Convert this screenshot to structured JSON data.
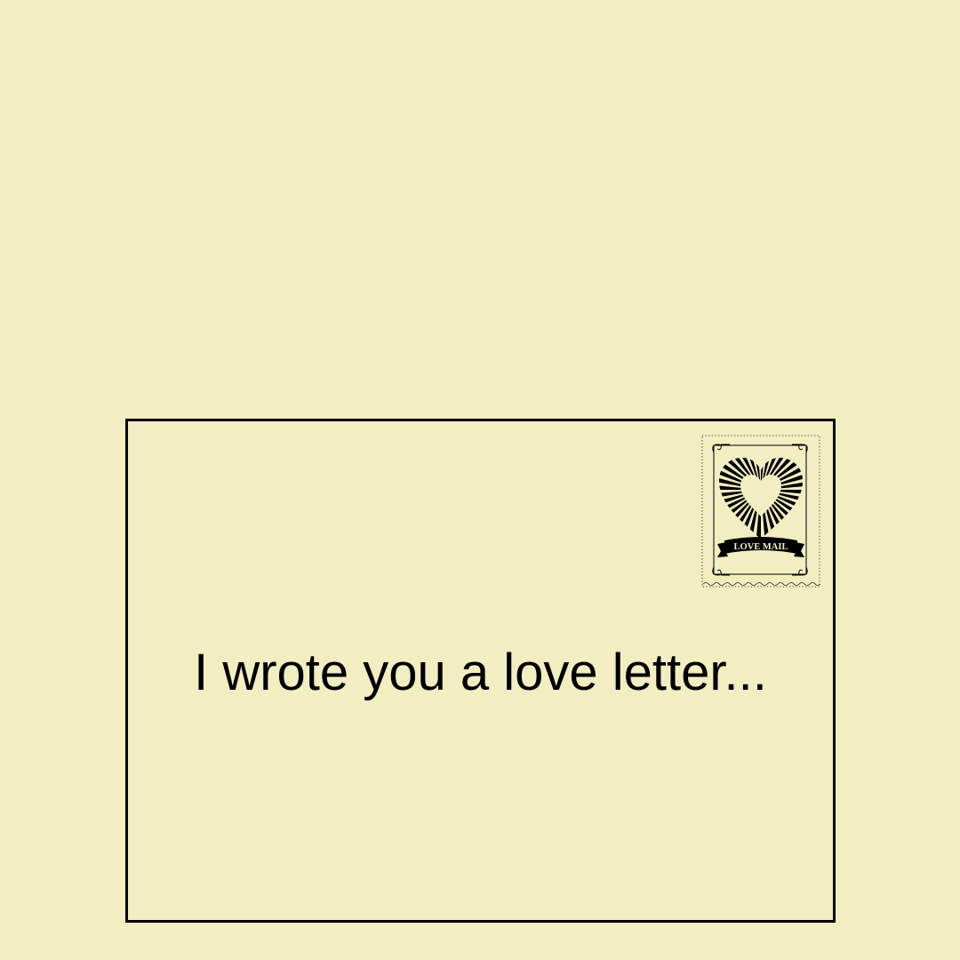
{
  "envelope": {
    "message": "I wrote you a love letter..."
  },
  "stamp": {
    "label": "LOVE MAIL",
    "icon": "heart-icon",
    "ink_color": "#000000"
  },
  "colors": {
    "background": "#f2eec1",
    "ink": "#000000"
  }
}
